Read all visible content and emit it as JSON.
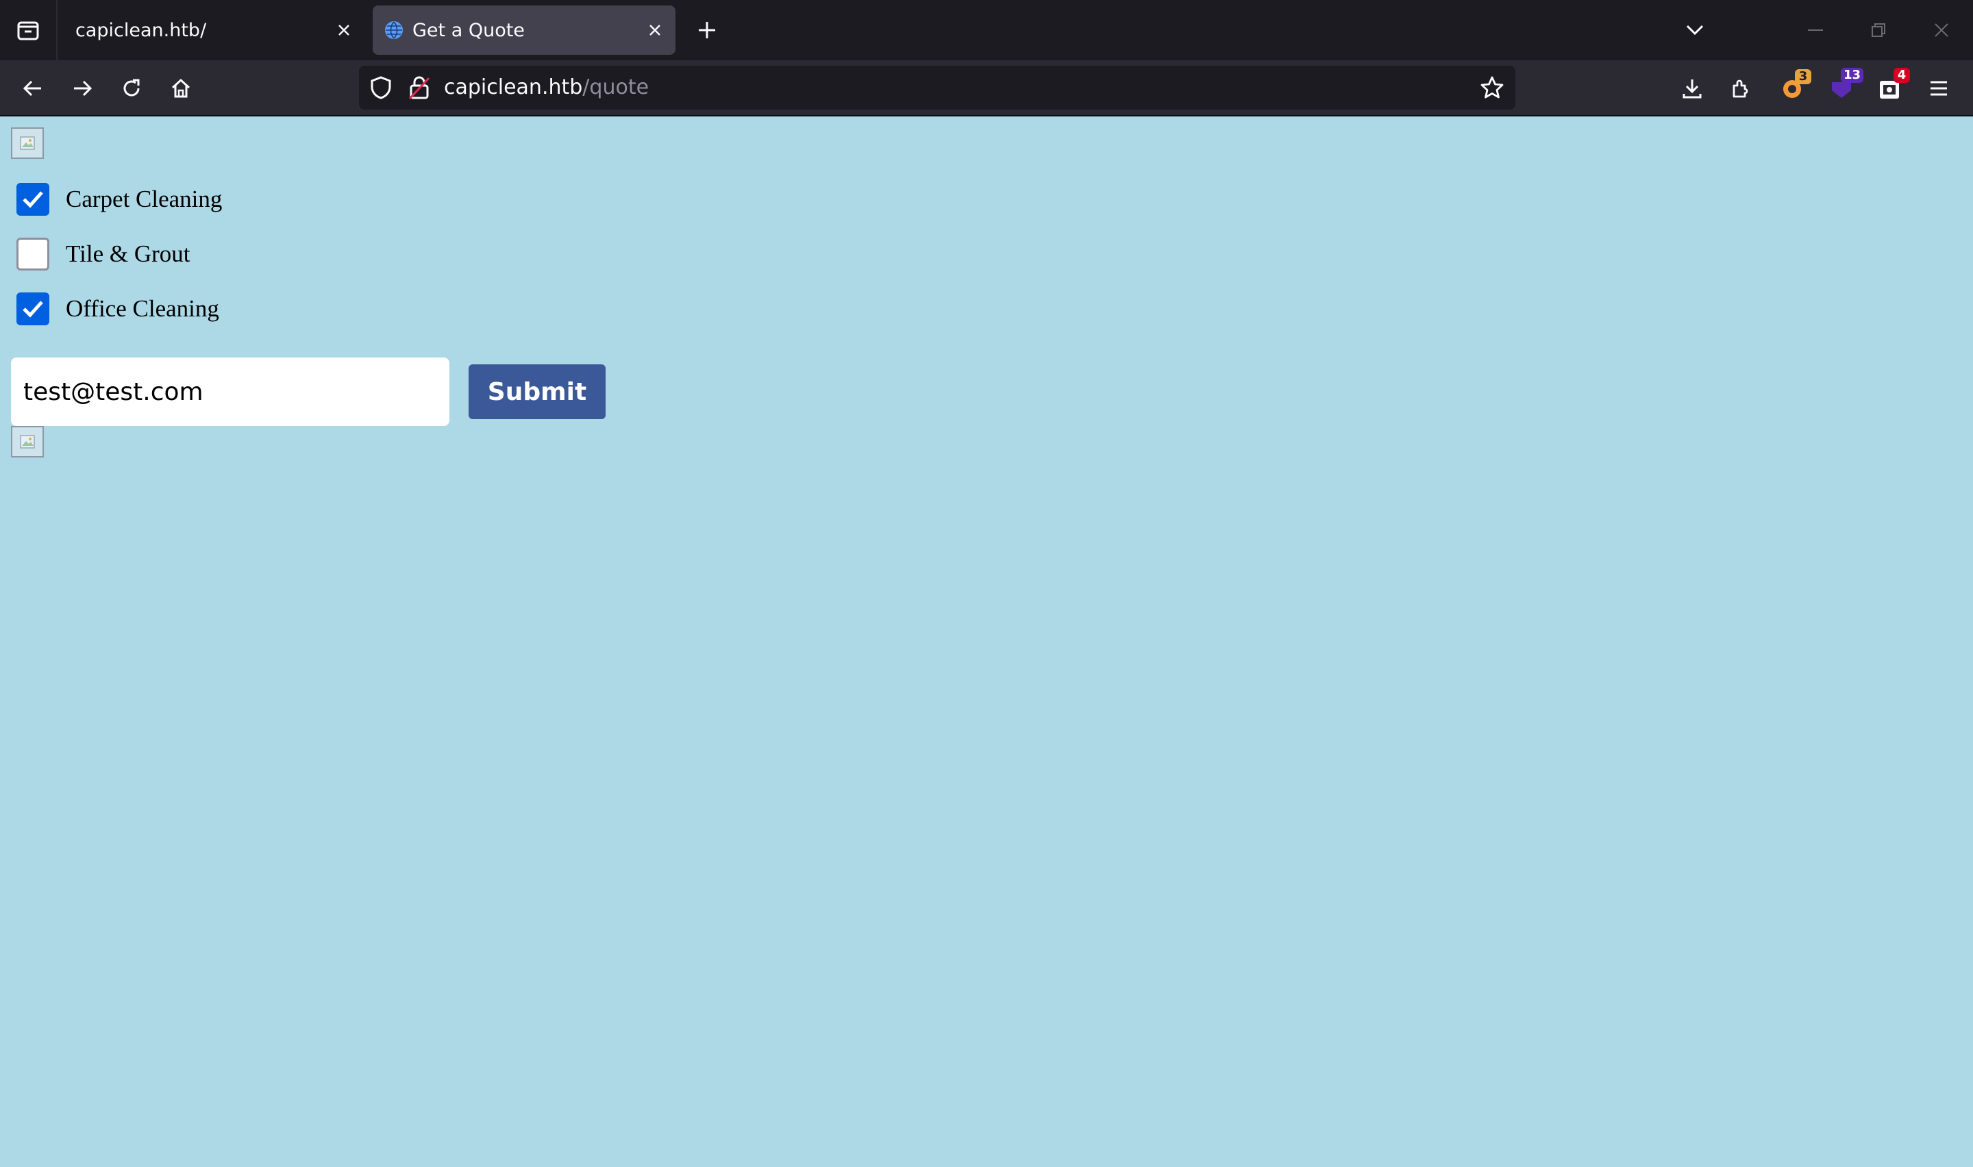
{
  "browser": {
    "tabs": [
      {
        "title": "capiclean.htb/",
        "active": false
      },
      {
        "title": "Get a Quote",
        "active": true
      }
    ],
    "url": {
      "host": "capiclean.htb",
      "path": "/quote"
    },
    "extensions": [
      {
        "name": "extension-a-icon",
        "badge": "3",
        "badge_color": "#e8a33d"
      },
      {
        "name": "extension-b-icon",
        "badge": "13",
        "badge_color": "#5b2bb5"
      },
      {
        "name": "extension-c-icon",
        "badge": "4",
        "badge_color": "#d70022"
      }
    ]
  },
  "form": {
    "services": [
      {
        "label": "Carpet Cleaning",
        "checked": true
      },
      {
        "label": "Tile & Grout",
        "checked": false
      },
      {
        "label": "Office Cleaning",
        "checked": true
      }
    ],
    "email_value": "test@test.com",
    "submit_label": "Submit"
  },
  "colors": {
    "page_background": "#add8e6",
    "submit_button": "#3b5998",
    "checkbox_checked": "#0060df"
  }
}
